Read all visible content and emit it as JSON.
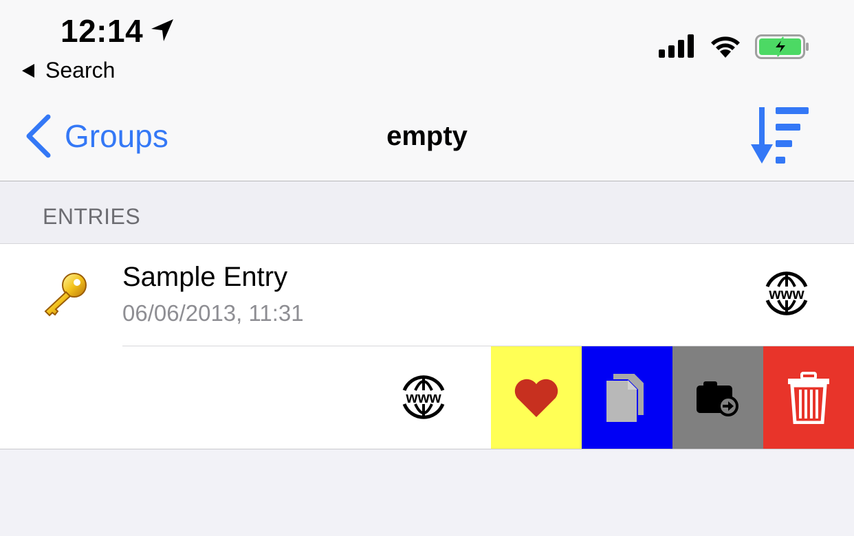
{
  "status_bar": {
    "time": "12:14",
    "back_app_label": "Search",
    "icons": [
      "location-arrow-icon",
      "cellular-signal-icon",
      "wifi-icon",
      "battery-charging-icon"
    ]
  },
  "nav_bar": {
    "back_label": "Groups",
    "title": "empty",
    "sort_icon": "sort-descending-icon"
  },
  "section": {
    "header": "ENTRIES"
  },
  "entries": [
    {
      "title": "Sample Entry",
      "subtitle": "06/06/2013, 11:31",
      "icon": "key-icon",
      "accessory_icon": "www-globe-icon"
    }
  ],
  "swipe_actions": [
    {
      "icon": "www-globe-icon",
      "color": "#ffffff"
    },
    {
      "icon": "heart-icon",
      "color": "#ffff55"
    },
    {
      "icon": "copy-icon",
      "color": "#0000f5"
    },
    {
      "icon": "camera-move-icon",
      "color": "#808080"
    },
    {
      "icon": "trash-icon",
      "color": "#e8342a"
    }
  ],
  "colors": {
    "accent": "#3478f6",
    "battery_green": "#4cd964"
  }
}
